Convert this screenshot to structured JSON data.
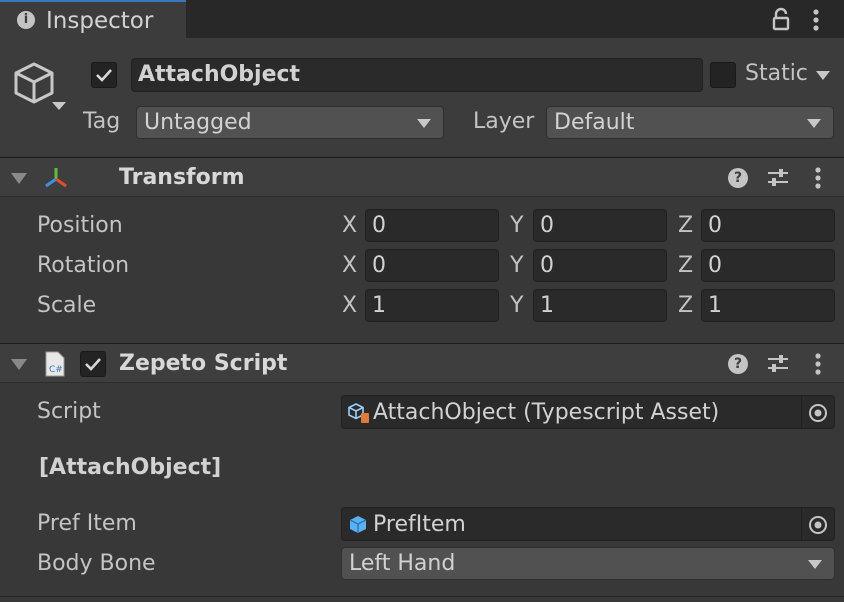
{
  "window": {
    "tab_title": "Inspector"
  },
  "header": {
    "active": true,
    "object_name": "AttachObject",
    "static_label": "Static",
    "tag_label": "Tag",
    "tag_value": "Untagged",
    "layer_label": "Layer",
    "layer_value": "Default"
  },
  "transform": {
    "title": "Transform",
    "rows": [
      {
        "label": "Position",
        "x": "0",
        "y": "0",
        "z": "0"
      },
      {
        "label": "Rotation",
        "x": "0",
        "y": "0",
        "z": "0"
      },
      {
        "label": "Scale",
        "x": "1",
        "y": "1",
        "z": "1"
      }
    ],
    "axis": {
      "x": "X",
      "y": "Y",
      "z": "Z"
    }
  },
  "zepeto": {
    "title": "Zepeto Script",
    "enabled": true,
    "script_label": "Script",
    "script_value": "AttachObject (Typescript Asset)",
    "section_header": "[AttachObject]",
    "pref_item_label": "Pref Item",
    "pref_item_value": "PrefItem",
    "body_bone_label": "Body Bone",
    "body_bone_value": "Left Hand"
  },
  "icons": [
    "info-icon",
    "lock-icon",
    "more-icon",
    "gameobject-cube-icon",
    "transform-axes-icon",
    "csharp-script-icon",
    "help-icon",
    "preset-sliders-icon",
    "typescript-asset-icon",
    "prefab-cube-icon",
    "object-picker-icon",
    "check-icon",
    "dropdown-arrow-icon",
    "foldout-arrow-icon"
  ],
  "colors": {
    "accent": "#3a79bb",
    "background": "#383838",
    "field": "#2a2a2a"
  }
}
